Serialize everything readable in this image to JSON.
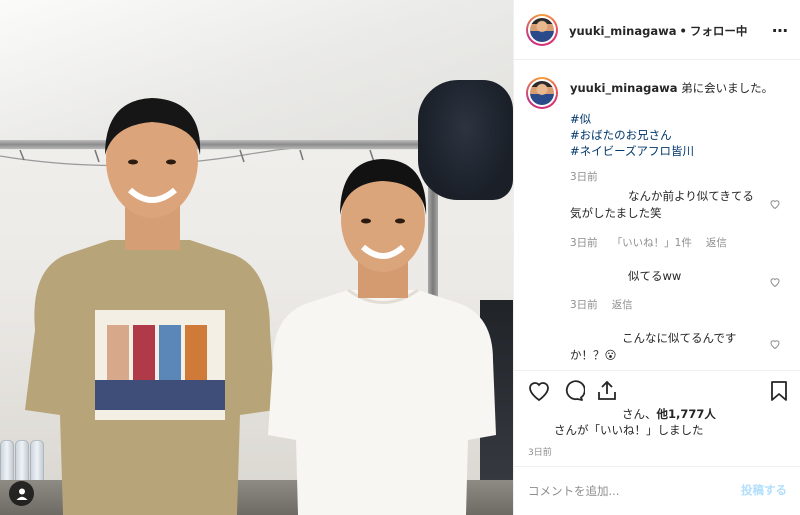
{
  "header": {
    "username": "yuuki_minagawa",
    "separator": "•",
    "follow_status": "フォロー中",
    "more_icon": "more-options-icon"
  },
  "caption": {
    "username": "yuuki_minagawa",
    "text": "弟に会いました。",
    "hashtags": [
      "#似",
      "#おばたのお兄さん",
      "#ネイビーズアフロ皆川"
    ],
    "time": "3日前"
  },
  "comments": [
    {
      "text": "なんか前より似てきてる気がしたました笑",
      "time": "3日前",
      "likes": "「いいね！」1件",
      "reply": "返信"
    },
    {
      "text": "似てるww",
      "time": "3日前",
      "reply": "返信"
    },
    {
      "text": "こんなに似てるんですか！？😮"
    }
  ],
  "likes": {
    "prefix": "さん、",
    "count": "他1,777人",
    "liked_line": "さんが「いいね！」しました"
  },
  "post_date": "3日前",
  "comment_box": {
    "placeholder": "コメントを追加...",
    "post_label": "投稿する"
  },
  "colors": {
    "hashtag": "#00376b",
    "muted": "#8e8e8e",
    "post_disabled": "#b2dffc"
  }
}
